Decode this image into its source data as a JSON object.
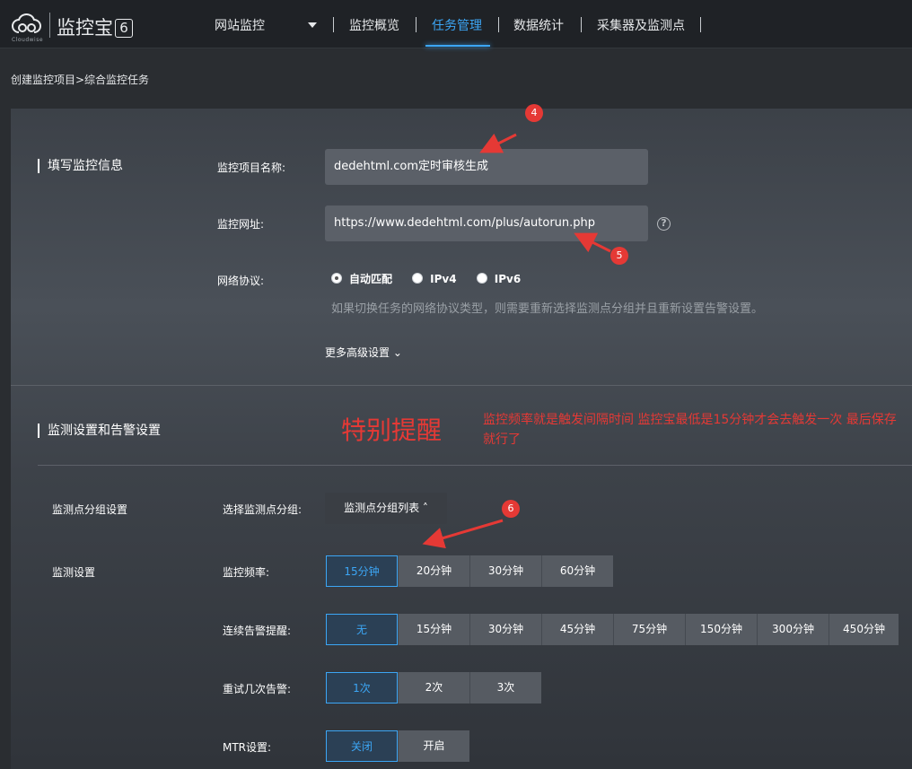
{
  "header": {
    "logo_sub": "Cloudwise",
    "logo_title": "监控宝",
    "logo_version": "6",
    "nav": [
      {
        "label": "网站监控"
      },
      {
        "label": "监控概览"
      },
      {
        "label": "任务管理"
      },
      {
        "label": "数据统计"
      },
      {
        "label": "采集器及监测点"
      }
    ]
  },
  "breadcrumb": "创建监控项目>综合监控任务",
  "section1": {
    "title": "填写监控信息",
    "name_label": "监控项目名称:",
    "name_value": "dedehtml.com定时审核生成",
    "url_label": "监控网址:",
    "url_value": "https://www.dedehtml.com/plus/autorun.php",
    "protocol_label": "网络协议:",
    "protocol_options": [
      "自动匹配",
      "IPv4",
      "IPv6"
    ],
    "protocol_hint": "如果切换任务的网络协议类型，则需要重新选择监测点分组并且重新设置告警设置。",
    "advanced": "更多高级设置"
  },
  "section2": {
    "title": "监测设置和告警设置",
    "notice_big": "特别提醒",
    "notice_text": "监控频率就是触发间隔时间 监控宝最低是15分钟才会去触发一次 最后保存就行了",
    "group_setting": "监测点分组设置",
    "choose_group_label": "选择监测点分组:",
    "group_list_btn": "监测点分组列表",
    "monitor_setting": "监测设置",
    "freq_label": "监控频率:",
    "freq_options": [
      "15分钟",
      "20分钟",
      "30分钟",
      "60分钟"
    ],
    "alert_label": "连续告警提醒:",
    "alert_options": [
      "无",
      "15分钟",
      "30分钟",
      "45分钟",
      "75分钟",
      "150分钟",
      "300分钟",
      "450分钟"
    ],
    "retry_label": "重试几次告警:",
    "retry_options": [
      "1次",
      "2次",
      "3次"
    ],
    "mtr_label": "MTR设置:",
    "mtr_options": [
      "关闭",
      "开启"
    ]
  },
  "badges": [
    "4",
    "5",
    "6"
  ],
  "colors": {
    "accent": "#3ca6f5",
    "alert": "#e53935"
  }
}
